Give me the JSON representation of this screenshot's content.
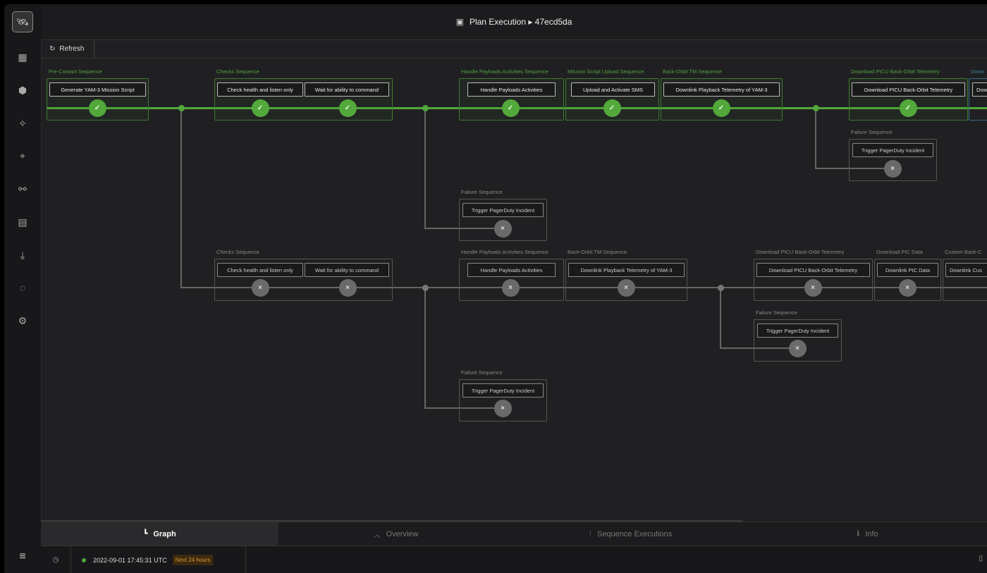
{
  "header": {
    "title": "Plan Execution ▸ 47ecd5da",
    "icon": "calendar-icon"
  },
  "toolbar": {
    "refresh_label": "Refresh",
    "refresh_icon": "refresh-icon"
  },
  "sidebar": {
    "logo_icon": "satellite-icon",
    "items": [
      "dashboard-icon",
      "cube-icon",
      "satellite-icon",
      "antenna-icon",
      "network-icon",
      "calendar-icon",
      "download-icon",
      "loading-icon",
      "settings-icon"
    ],
    "menu_icon": "menu-icon"
  },
  "graph": {
    "row1_groups": {
      "g1": "Pre-Contact Sequence",
      "g2": "Checks Sequence",
      "g3": "Handle Payloads Activities Sequence",
      "g4": "Mission Script Upload Sequence",
      "g5": "Back-Orbit TM Sequence",
      "g6": "Download PICU Back-Orbit Telemetry",
      "g7": "Down"
    },
    "row1_tasks": {
      "t1": "Generate YAM-3 Mission Script",
      "t2": "Check health and listen only",
      "t3": "Wait for ability to command",
      "t4": "Handle Payloads Activities",
      "t5": "Upload and Activate SMS",
      "t6": "Downlink Playback Telemetry of YAM-3",
      "t7": "Download PICU Back-Orbit Telemetry",
      "t8": "Dow"
    },
    "failure": {
      "label": "Failure Sequence",
      "task": "Trigger PagerDuty Incident",
      "task_truncated": "Trigger PagerDuty Incident"
    },
    "row2_groups": {
      "g1": "Checks Sequence",
      "g2": "Handle Payloads Activities Sequence",
      "g3": "Back-Orbit TM Sequence",
      "g4": "Download PICU Back-Orbit Telemetry",
      "g5": "Download PIC Data",
      "g6": "Custom Back-C"
    },
    "row2_tasks": {
      "t1": "Check health and listen only",
      "t2": "Wait for ability to command",
      "t3": "Handle Payloads Activities",
      "t4": "Downlink Playback Telemetry of YAM-3",
      "t5": "Download PICU Back-Orbit Telemetry",
      "t6": "Downlink PIC Data",
      "t7": "Downlink Cus"
    },
    "check_mark": "✓",
    "x_mark": "×"
  },
  "tabs": [
    {
      "label": "Graph",
      "icon": "graph-icon",
      "active": true
    },
    {
      "label": "Overview",
      "icon": "chevron-up-icon"
    },
    {
      "label": "Sequence Executions",
      "icon": "list-icon"
    },
    {
      "label": "Info",
      "icon": "info-icon"
    }
  ],
  "status": {
    "timestamp": "2022-09-01 17:45:31 UTC",
    "range_badge": "Next 24 hours",
    "online_color": "#52a83a"
  },
  "colors": {
    "success": "#52a83a",
    "pending": "#6a6a6a",
    "badge": "#e0962a"
  }
}
